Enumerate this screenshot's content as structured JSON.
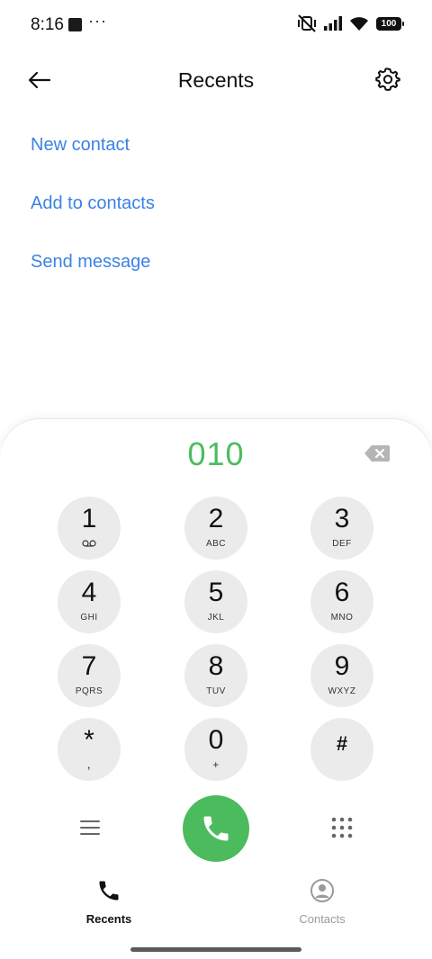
{
  "status_bar": {
    "time": "8:16",
    "dots": "···",
    "battery": "100"
  },
  "header": {
    "title": "Recents"
  },
  "actions": [
    {
      "label": "New contact"
    },
    {
      "label": "Add to contacts"
    },
    {
      "label": "Send message"
    }
  ],
  "dialer": {
    "number": "010",
    "keys": [
      {
        "digit": "1",
        "letters": ""
      },
      {
        "digit": "2",
        "letters": "ABC"
      },
      {
        "digit": "3",
        "letters": "DEF"
      },
      {
        "digit": "4",
        "letters": "GHI"
      },
      {
        "digit": "5",
        "letters": "JKL"
      },
      {
        "digit": "6",
        "letters": "MNO"
      },
      {
        "digit": "7",
        "letters": "PQRS"
      },
      {
        "digit": "8",
        "letters": "TUV"
      },
      {
        "digit": "9",
        "letters": "WXYZ"
      },
      {
        "digit": "*",
        "letters": ","
      },
      {
        "digit": "0",
        "letters": "+"
      },
      {
        "digit": "#",
        "letters": ""
      }
    ]
  },
  "nav": {
    "recents_label": "Recents",
    "contacts_label": "Contacts"
  },
  "colors": {
    "accent_link": "#3b82e6",
    "number_green": "#4bbd5f",
    "call_green": "#4cbb5e",
    "key_bg": "#ebebeb"
  },
  "icons": {
    "status_left": "notification-square-icon",
    "status_right": [
      "vibrate-off-icon",
      "signal-icon",
      "wifi-icon",
      "battery-icon"
    ],
    "header": [
      "back-arrow-icon",
      "gear-icon"
    ],
    "dialer": [
      "backspace-icon",
      "voicemail-icon",
      "menu-icon",
      "phone-icon",
      "dialpad-grid-icon"
    ],
    "nav": [
      "phone-icon",
      "person-circle-icon"
    ]
  }
}
